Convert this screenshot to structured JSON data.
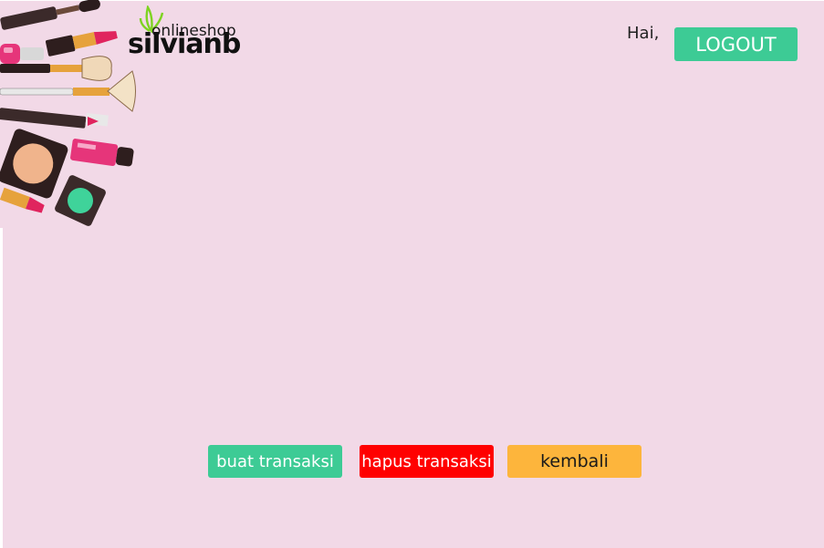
{
  "header": {
    "logo": {
      "small_text": "onlineshop",
      "brand_text": "silvianb"
    },
    "greeting": "Hai,",
    "logout_label": "LOGOUT"
  },
  "actions": {
    "create_label": "buat transaksi",
    "delete_label": "hapus transaksi",
    "back_label": "kembali"
  },
  "colors": {
    "background": "#f2d9e7",
    "primary": "#3dcb95",
    "danger": "#ff0000",
    "warning": "#fdb53c",
    "logo_leaf": "#7ed321"
  },
  "icons": {
    "decoration": "cosmetics-illustration",
    "logo_leaf": "leaf-icon"
  }
}
